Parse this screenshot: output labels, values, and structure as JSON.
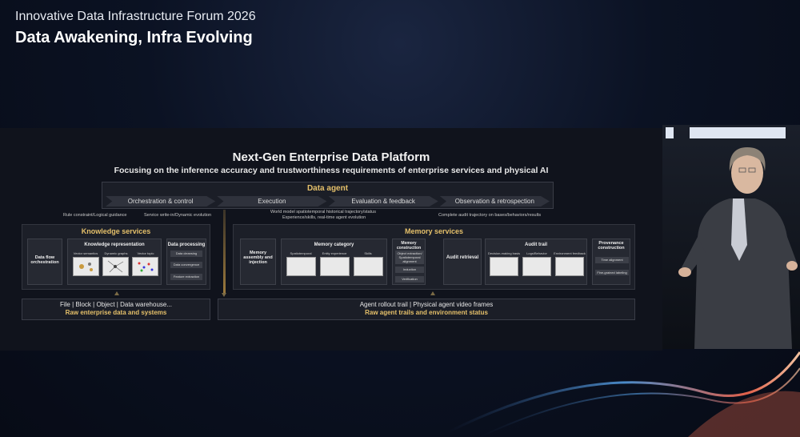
{
  "event": {
    "line1": "Innovative Data Infrastructure Forum 2026",
    "title": "Data Awakening, Infra Evolving"
  },
  "slide": {
    "title": "Next-Gen Enterprise Data Platform",
    "subtitle": "Focusing on the inference accuracy and trustworthiness requirements of enterprise services and physical AI",
    "agent": {
      "title": "Data agent",
      "steps": [
        "Orchestration & control",
        "Execution",
        "Evaluation & feedback",
        "Observation & retrospection"
      ]
    },
    "notes": {
      "n1": "Rule constraint/Logical guidance",
      "n2": "Service write-in/Dynamic evolution",
      "n3a": "World model spatiotemporal historical trajectory/status",
      "n3b": "Experience/skills, real-time agent evolution",
      "n4": "Complete audit trajectory on bases/behaviors/results"
    },
    "knowledge": {
      "title": "Knowledge services",
      "flow": "Data flow orchestration",
      "repr_title": "Knowledge representation",
      "repr_items": [
        "Vector semantics",
        "Dynamic graphs",
        "Vector topic"
      ],
      "proc_title": "Data processing",
      "proc_items": [
        "Data cleansing",
        "Data convergence",
        "Feature extraction"
      ]
    },
    "memory": {
      "title": "Memory services",
      "assembly": "Memory assembly and injection",
      "category_title": "Memory category",
      "category_items": [
        "Spatiotemporal",
        "Entity experience",
        "Skills"
      ],
      "construction_title": "Memory construction",
      "construction_items": [
        "Object extraction/ Spatiotemporal alignment",
        "Induction",
        "Verification"
      ],
      "audit_retrieval": "Audit retrieval",
      "audit_title": "Audit trail",
      "audit_items": [
        "Decision-making basis",
        "Logs/Behavior",
        "Environment feedback"
      ],
      "prov_title": "Provenance construction",
      "prov_items": [
        "Time alignment",
        "Fine-grained labeling"
      ]
    },
    "bottom_left": {
      "line1": "File | Block | Object | Data warehouse...",
      "line2": "Raw enterprise data and systems"
    },
    "bottom_right": {
      "line1": "Agent rollout trail | Physical agent video frames",
      "line2": "Raw agent trails and environment status"
    }
  },
  "colors": {
    "accent": "#e5c06a",
    "panel": "#1c1f28"
  }
}
